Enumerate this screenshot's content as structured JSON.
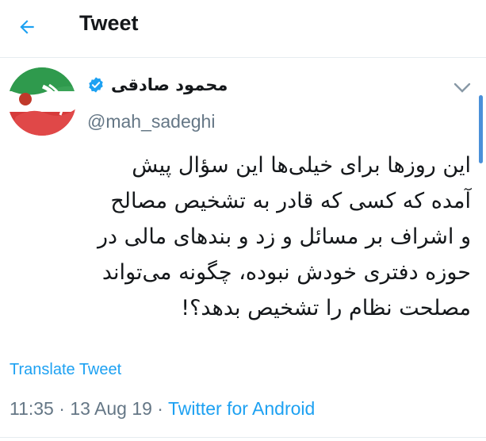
{
  "header": {
    "title": "Tweet",
    "back_icon": "arrow-left-icon"
  },
  "author": {
    "display_name": "محمود صادقی",
    "handle": "@mah_sadeghi",
    "verified_icon": "verified-badge-icon"
  },
  "tweet": {
    "lines": [
      "این روزها برای خیلی‌ها این سؤال پیش",
      "آمده که کسی که قادر به تشخیص مصالح",
      "و اشراف بر مسائل و زد و بندهای مالی در",
      "حوزه دفتری خودش نبوده، چگونه می‌تواند",
      "مصلحت نظام را تشخیص بدهد؟!"
    ],
    "translate_label": "Translate Tweet",
    "time": "11:35",
    "date": "13 Aug 19",
    "separator": " · ",
    "source": "Twitter for Android"
  },
  "colors": {
    "accent": "#1da1f2",
    "muted": "#657786",
    "text": "#14171a"
  }
}
